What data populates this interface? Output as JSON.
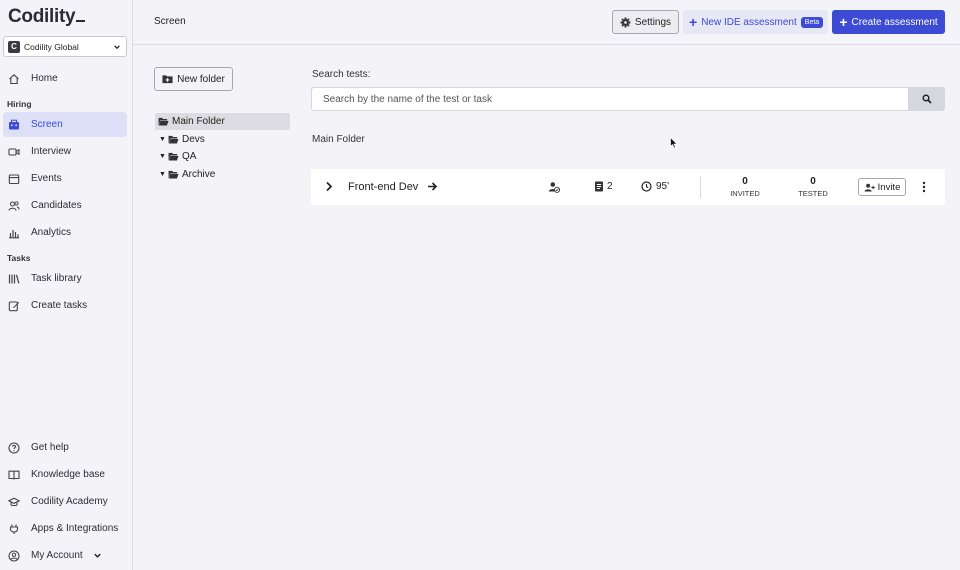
{
  "brand": {
    "logo_text": "Codility",
    "org_initial": "C",
    "org_name": "Codility Global"
  },
  "sidebar": {
    "home": "Home",
    "hiring_label": "Hiring",
    "screen": "Screen",
    "interview": "Interview",
    "events": "Events",
    "candidates": "Candidates",
    "analytics": "Analytics",
    "tasks_label": "Tasks",
    "task_library": "Task library",
    "create_tasks": "Create tasks",
    "get_help": "Get help",
    "knowledge_base": "Knowledge base",
    "academy": "Codility Academy",
    "apps": "Apps & Integrations",
    "account": "My Account"
  },
  "header": {
    "title": "Screen",
    "settings_label": "Settings",
    "new_ide_label": "New IDE assessment",
    "beta_badge": "Beta",
    "create_label": "Create assessment"
  },
  "folders": {
    "new_folder_label": "New folder",
    "main": "Main Folder",
    "devs": "Devs",
    "qa": "QA",
    "archive": "Archive"
  },
  "search": {
    "label": "Search tests:",
    "placeholder": "Search by the name of the test or task",
    "value": ""
  },
  "current_folder": "Main Folder",
  "test": {
    "name": "Front-end Dev",
    "tasks": "2",
    "duration": "95'",
    "invited_count": "0",
    "invited_label": "INVITED",
    "tested_count": "0",
    "tested_label": "TESTED",
    "invite_label": "Invite"
  },
  "colors": {
    "accent": "#3d4ad3",
    "active_nav_bg": "#dde0f6",
    "background": "#f4f4f8"
  }
}
